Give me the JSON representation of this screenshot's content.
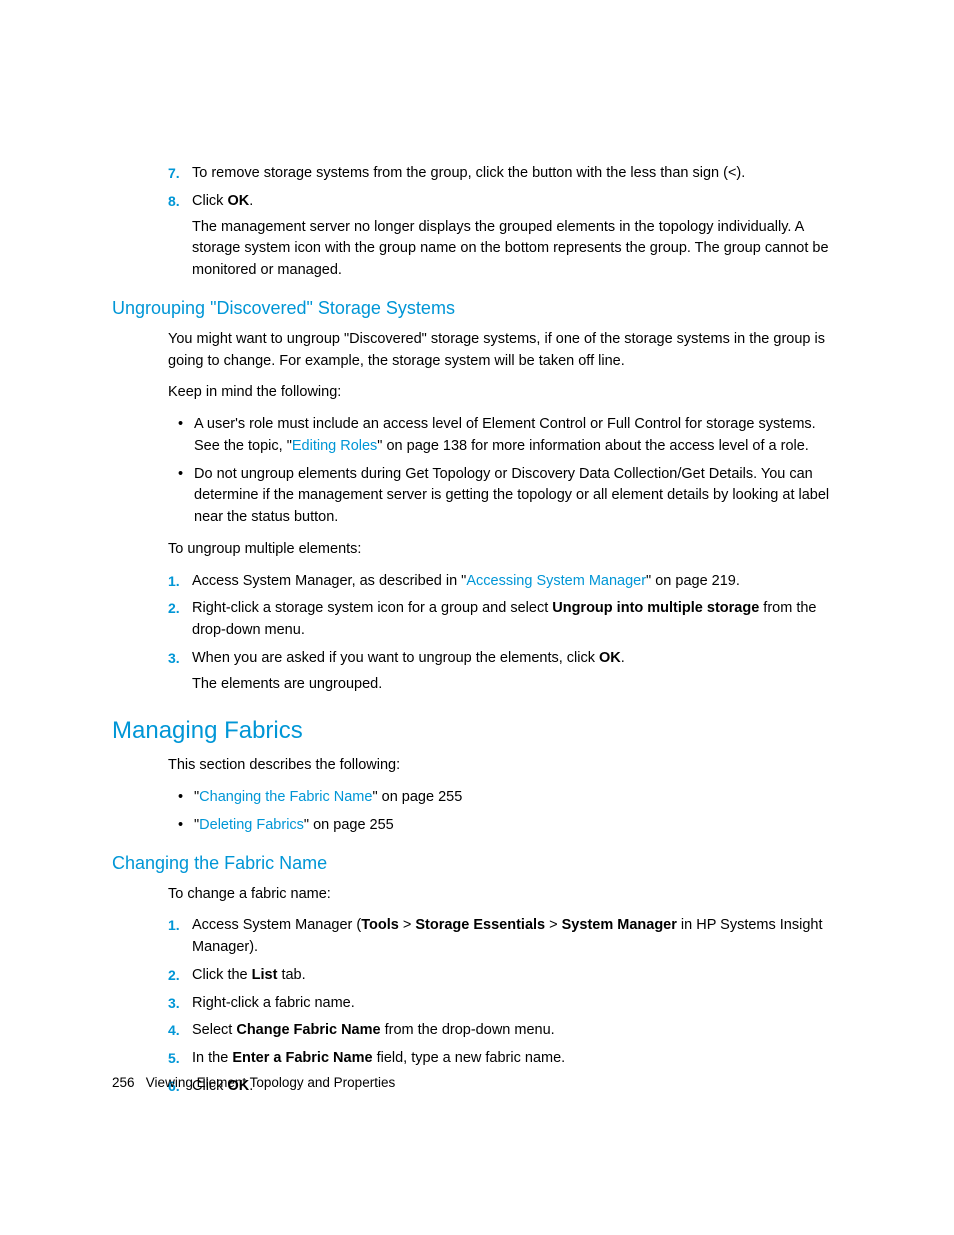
{
  "steps_a": {
    "n7": "7.",
    "t7": "To remove storage systems from the group, click the button with the less than sign (<).",
    "n8": "8.",
    "t8a": "Click ",
    "t8b": "OK",
    "t8c": ".",
    "t8_para": "The management server no longer displays the grouped elements in the topology individually. A storage system icon with the group name on the bottom represents the group. The group cannot be monitored or managed."
  },
  "h_ungroup": "Ungrouping \"Discovered\" Storage Systems",
  "ungroup": {
    "p1": "You might want to ungroup \"Discovered\" storage systems, if one of the storage systems in the group is going to change. For example, the storage system will be taken off line.",
    "p2": "Keep in mind the following:",
    "b1a": "A user's role must include an access level of Element Control or Full Control for storage systems. See the topic, \"",
    "b1_link": "Editing Roles",
    "b1b": "\" on page 138 for more information about the access level of a role.",
    "b2": "Do not ungroup elements during Get Topology or Discovery Data Collection/Get Details. You can determine if the management server is getting the topology or all element details by looking at label near the status button.",
    "p3": "To ungroup multiple elements:",
    "s1n": "1.",
    "s1a": "Access System Manager, as described in \"",
    "s1_link": "Accessing System Manager",
    "s1b": "\" on page 219.",
    "s2n": "2.",
    "s2a": "Right-click a storage system icon for a group and select ",
    "s2_bold": "Ungroup into multiple storage",
    "s2b": " from the drop-down menu.",
    "s3n": "3.",
    "s3a": "When you are asked if you want to ungroup the elements, click ",
    "s3_bold": "OK",
    "s3b": ".",
    "s3_para": "The elements are ungrouped."
  },
  "h_fabrics": "Managing Fabrics",
  "fabrics": {
    "p1": "This section describes the following:",
    "b1a": "\"",
    "b1_link": "Changing the Fabric Name",
    "b1b": "\" on page 255",
    "b2a": "\"",
    "b2_link": "Deleting Fabrics",
    "b2b": "\" on page 255"
  },
  "h_change": "Changing the Fabric Name",
  "change": {
    "p1": "To change a fabric name:",
    "s1n": "1.",
    "s1a": "Access System Manager (",
    "s1_b1": "Tools",
    "s1_gt1": " > ",
    "s1_b2": "Storage Essentials",
    "s1_gt2": " > ",
    "s1_b3": "System Manager",
    "s1b": " in HP Systems Insight Manager).",
    "s2n": "2.",
    "s2a": "Click the ",
    "s2_bold": "List",
    "s2b": " tab.",
    "s3n": "3.",
    "s3": "Right-click a fabric name.",
    "s4n": "4.",
    "s4a": "Select ",
    "s4_bold": "Change Fabric Name",
    "s4b": " from the drop-down menu.",
    "s5n": "5.",
    "s5a": "In the ",
    "s5_bold": "Enter a Fabric Name",
    "s5b": " field, type a new fabric name.",
    "s6n": "6.",
    "s6a": "Click ",
    "s6_bold": "OK",
    "s6b": "."
  },
  "footer": {
    "page": "256",
    "title": "Viewing Element Topology and Properties"
  }
}
